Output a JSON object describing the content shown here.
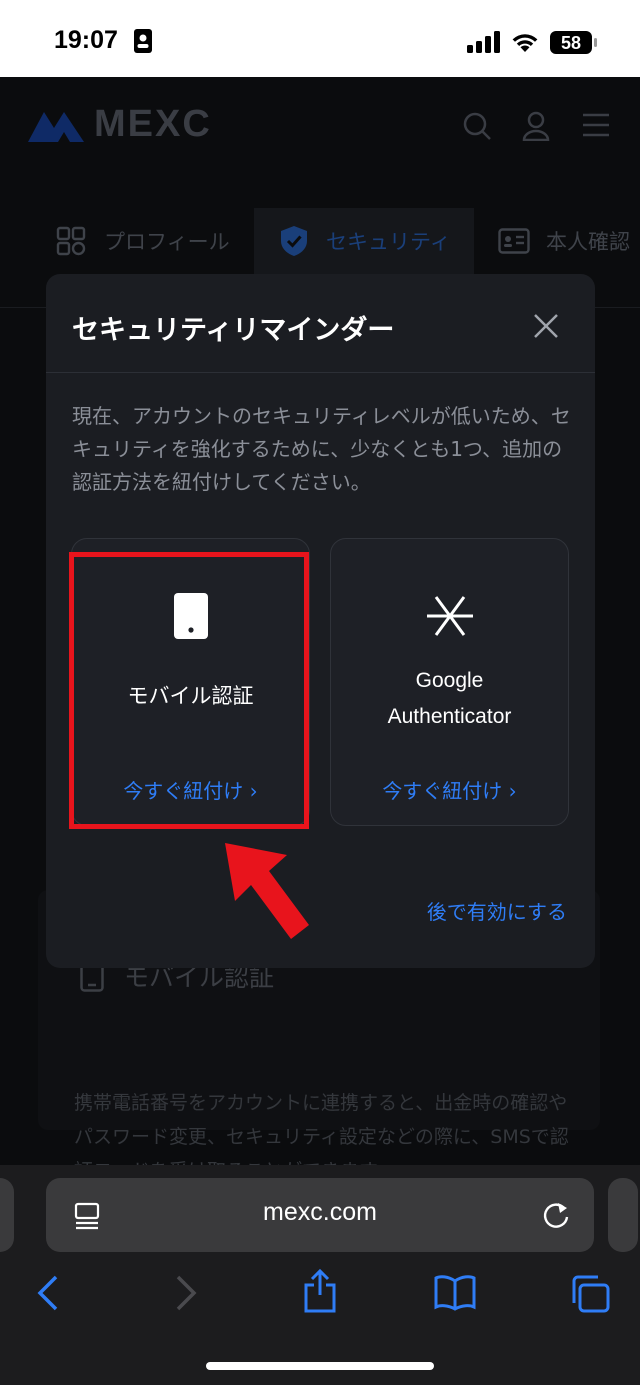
{
  "status_bar": {
    "time": "19:07",
    "battery": "58"
  },
  "header": {
    "logo_text": "MEXC"
  },
  "tabs": [
    {
      "label": "プロフィール"
    },
    {
      "label": "セキュリティ"
    },
    {
      "label": "本人確認"
    }
  ],
  "background_section": {
    "title": "モバイル認証",
    "description": "携帯電話番号をアカウントに連携すると、出金時の確認やパスワード変更、セキュリティ設定などの際に、SMSで認証コードを受け取ることができます。"
  },
  "modal": {
    "title": "セキュリティリマインダー",
    "description": "現在、アカウントのセキュリティレベルが低いため、セキュリティを強化するために、少なくとも1つ、追加の認証方法を紐付けしてください。",
    "options": [
      {
        "label": "モバイル認証",
        "link": "今すぐ紐付け",
        "icon": "phone-icon"
      },
      {
        "label_line1": "Google",
        "label_line2": "Authenticator",
        "link": "今すぐ紐付け",
        "icon": "authenticator-icon"
      }
    ],
    "later_link": "後で有効にする"
  },
  "annotation": {
    "highlight_color": "#e8141c"
  },
  "browser": {
    "url": "mexc.com"
  },
  "colors": {
    "accent": "#2f7df6",
    "modal_bg": "#1b1d22"
  }
}
